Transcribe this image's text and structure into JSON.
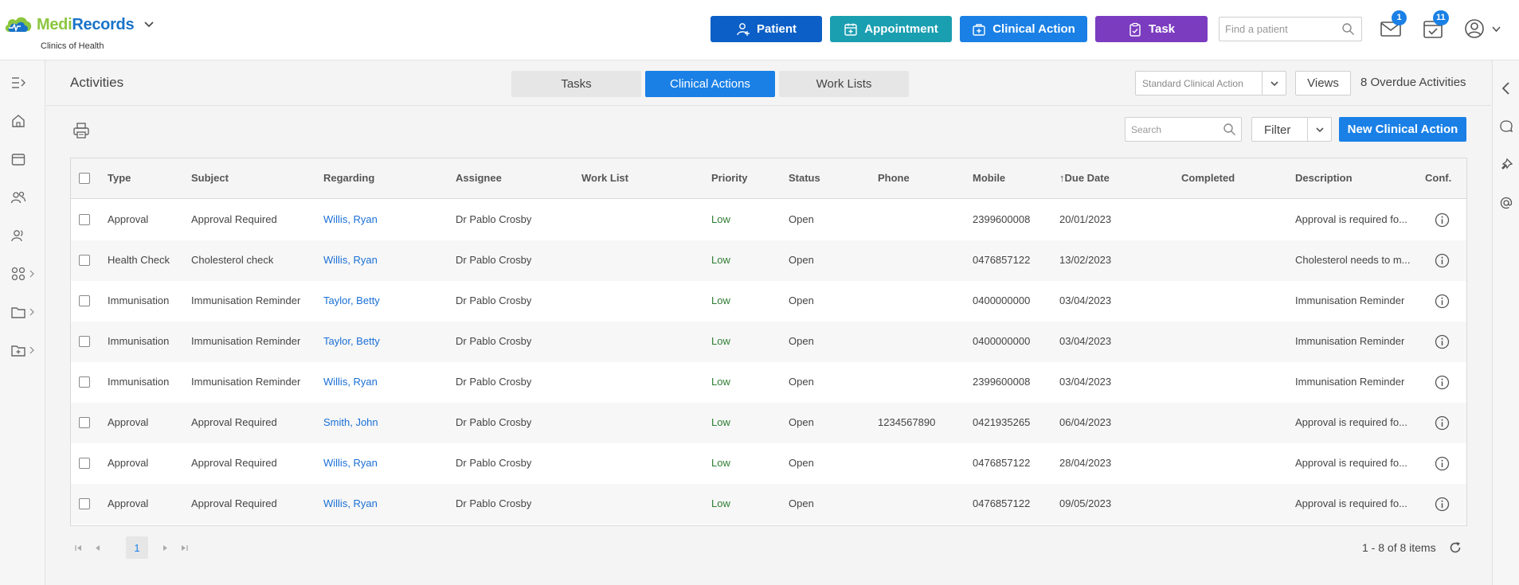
{
  "app": {
    "logo_part1": "Medi",
    "logo_part2": "Records",
    "clinic": "Clinics of Health"
  },
  "header": {
    "buttons": [
      {
        "label": "Patient",
        "icon": "add-person-icon",
        "color": "#0b5fc6"
      },
      {
        "label": "Appointment",
        "icon": "calendar-icon",
        "color": "#1a9fb1"
      },
      {
        "label": "Clinical Action",
        "icon": "medical-case-icon",
        "color": "#1a80e6"
      },
      {
        "label": "Task",
        "icon": "clipboard-icon",
        "color": "#7b3cc0"
      }
    ],
    "find_patient_placeholder": "Find a patient",
    "mail_badge": "1",
    "tasks_badge": "11"
  },
  "page": {
    "title": "Activities",
    "tabs": [
      {
        "label": "Tasks",
        "active": false
      },
      {
        "label": "Clinical Actions",
        "active": true
      },
      {
        "label": "Work Lists",
        "active": false
      }
    ],
    "view_select": "Standard Clinical Action",
    "views_label": "Views",
    "overdue": "8 Overdue Activities",
    "search_placeholder": "Search",
    "filter_label": "Filter",
    "new_label": "New Clinical Action"
  },
  "table": {
    "columns": [
      "Type",
      "Subject",
      "Regarding",
      "Assignee",
      "Work List",
      "Priority",
      "Status",
      "Phone",
      "Mobile",
      "↑Due Date",
      "Completed",
      "Description",
      "Conf."
    ],
    "rows": [
      [
        "Approval",
        "Approval Required",
        "Willis, Ryan",
        "Dr Pablo Crosby",
        "",
        "Low",
        "Open",
        "",
        "2399600008",
        "20/01/2023",
        "",
        "Approval is required fo..."
      ],
      [
        "Health Check",
        "Cholesterol check",
        "Willis, Ryan",
        "Dr Pablo Crosby",
        "",
        "Low",
        "Open",
        "",
        "0476857122",
        "13/02/2023",
        "",
        "Cholesterol needs to m..."
      ],
      [
        "Immunisation",
        "Immunisation Reminder",
        "Taylor, Betty",
        "Dr Pablo Crosby",
        "",
        "Low",
        "Open",
        "",
        "0400000000",
        "03/04/2023",
        "",
        "Immunisation Reminder"
      ],
      [
        "Immunisation",
        "Immunisation Reminder",
        "Taylor, Betty",
        "Dr Pablo Crosby",
        "",
        "Low",
        "Open",
        "",
        "0400000000",
        "03/04/2023",
        "",
        "Immunisation Reminder"
      ],
      [
        "Immunisation",
        "Immunisation Reminder",
        "Willis, Ryan",
        "Dr Pablo Crosby",
        "",
        "Low",
        "Open",
        "",
        "2399600008",
        "03/04/2023",
        "",
        "Immunisation Reminder"
      ],
      [
        "Approval",
        "Approval Required",
        "Smith, John",
        "Dr Pablo Crosby",
        "",
        "Low",
        "Open",
        "1234567890",
        "0421935265",
        "06/04/2023",
        "",
        "Approval is required fo..."
      ],
      [
        "Approval",
        "Approval Required",
        "Willis, Ryan",
        "Dr Pablo Crosby",
        "",
        "Low",
        "Open",
        "",
        "0476857122",
        "28/04/2023",
        "",
        "Approval is required fo..."
      ],
      [
        "Approval",
        "Approval Required",
        "Willis, Ryan",
        "Dr Pablo Crosby",
        "",
        "Low",
        "Open",
        "",
        "0476857122",
        "09/05/2023",
        "",
        "Approval is required fo..."
      ]
    ]
  },
  "pager": {
    "page": "1",
    "summary": "1 - 8 of 8 items"
  }
}
